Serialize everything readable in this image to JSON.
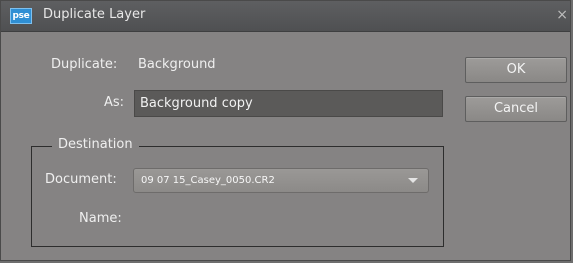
{
  "window": {
    "app_icon_text": "pse",
    "title": "Duplicate Layer",
    "close_glyph": "×"
  },
  "form": {
    "duplicate_label": "Duplicate:",
    "duplicate_value": "Background",
    "as_label": "As:",
    "as_value": "Background copy"
  },
  "buttons": {
    "ok_label": "OK",
    "cancel_label": "Cancel"
  },
  "destination": {
    "legend": "Destination",
    "document_label": "Document:",
    "document_selected": "09 07 15_Casey_0050.CR2",
    "name_label": "Name:",
    "name_value": ""
  },
  "icons": {
    "app": "pse-logo-icon",
    "close": "close-icon",
    "dropdown": "chevron-down-icon"
  }
}
